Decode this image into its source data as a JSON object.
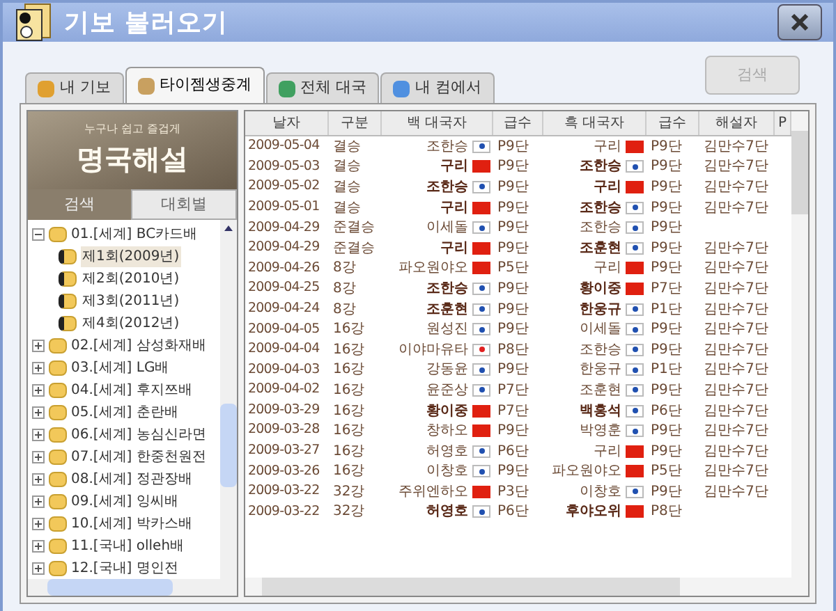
{
  "window": {
    "title": "기보 불러오기"
  },
  "tabs": [
    {
      "label": "내 기보",
      "selected": false
    },
    {
      "label": "타이젬생중계",
      "selected": true
    },
    {
      "label": "전체 대국",
      "selected": false
    },
    {
      "label": "내 컴에서",
      "selected": false
    }
  ],
  "search_button": {
    "label": "검색",
    "disabled": true
  },
  "banner": {
    "tagline": "누구나 쉽고 즐겁게",
    "title": "명국해설"
  },
  "filter_tabs": [
    {
      "label": "검색",
      "selected": true
    },
    {
      "label": "대회별",
      "selected": false
    }
  ],
  "tree": [
    {
      "label": "01.[세계] BC카드배",
      "expanded": true,
      "children": [
        {
          "label": "제1회(2009년)",
          "selected": true
        },
        {
          "label": "제2회(2010년)",
          "selected": false
        },
        {
          "label": "제3회(2011년)",
          "selected": false
        },
        {
          "label": "제4회(2012년)",
          "selected": false
        }
      ]
    },
    {
      "label": "02.[세계] 삼성화재배",
      "expanded": false
    },
    {
      "label": "03.[세계] LG배",
      "expanded": false
    },
    {
      "label": "04.[세계] 후지쯔배",
      "expanded": false
    },
    {
      "label": "05.[세계] 춘란배",
      "expanded": false
    },
    {
      "label": "06.[세계] 농심신라면",
      "expanded": false
    },
    {
      "label": "07.[세계] 한중천원전",
      "expanded": false
    },
    {
      "label": "08.[세계] 정관장배",
      "expanded": false
    },
    {
      "label": "09.[세계] 잉씨배",
      "expanded": false
    },
    {
      "label": "10.[세계] 박카스배",
      "expanded": false
    },
    {
      "label": "11.[국내] olleh배",
      "expanded": false
    },
    {
      "label": "12.[국내] 명인전",
      "expanded": false
    }
  ],
  "table": {
    "columns": [
      "날자",
      "구분",
      "백 대국자",
      "급수",
      "흑 대국자",
      "급수",
      "해설자",
      "P"
    ],
    "rows": [
      {
        "date": "2009-05-04",
        "round": "결승",
        "white": {
          "name": "조한승",
          "kind": "kr",
          "winner": false
        },
        "white_rank": "P9단",
        "black": {
          "name": "구리",
          "kind": "cn",
          "winner": false
        },
        "black_rank": "P9단",
        "commentator": "김만수7단"
      },
      {
        "date": "2009-05-03",
        "round": "결승",
        "white": {
          "name": "구리",
          "kind": "cn",
          "winner": true
        },
        "white_rank": "P9단",
        "black": {
          "name": "조한승",
          "kind": "kr",
          "winner": true
        },
        "black_rank": "P9단",
        "commentator": "김만수7단"
      },
      {
        "date": "2009-05-02",
        "round": "결승",
        "white": {
          "name": "조한승",
          "kind": "kr",
          "winner": true
        },
        "white_rank": "P9단",
        "black": {
          "name": "구리",
          "kind": "cn",
          "winner": true
        },
        "black_rank": "P9단",
        "commentator": "김만수7단"
      },
      {
        "date": "2009-05-01",
        "round": "결승",
        "white": {
          "name": "구리",
          "kind": "cn",
          "winner": true
        },
        "white_rank": "P9단",
        "black": {
          "name": "조한승",
          "kind": "kr",
          "winner": true
        },
        "black_rank": "P9단",
        "commentator": "김만수7단"
      },
      {
        "date": "2009-04-29",
        "round": "준결승",
        "white": {
          "name": "이세돌",
          "kind": "kr",
          "winner": false
        },
        "white_rank": "P9단",
        "black": {
          "name": "조한승",
          "kind": "kr",
          "winner": false
        },
        "black_rank": "P9단"
      },
      {
        "date": "2009-04-29",
        "round": "준결승",
        "white": {
          "name": "구리",
          "kind": "cn",
          "winner": true
        },
        "white_rank": "P9단",
        "black": {
          "name": "조훈현",
          "kind": "kr",
          "winner": true
        },
        "black_rank": "P9단",
        "commentator": "김만수7단"
      },
      {
        "date": "2009-04-26",
        "round": "8강",
        "white": {
          "name": "파오원야오",
          "kind": "cn",
          "winner": false
        },
        "white_rank": "P5단",
        "black": {
          "name": "구리",
          "kind": "cn",
          "winner": false
        },
        "black_rank": "P9단",
        "commentator": "김만수7단"
      },
      {
        "date": "2009-04-25",
        "round": "8강",
        "white": {
          "name": "조한승",
          "kind": "kr",
          "winner": true
        },
        "white_rank": "P9단",
        "black": {
          "name": "황이중",
          "kind": "cn",
          "winner": true
        },
        "black_rank": "P7단",
        "commentator": "김만수7단"
      },
      {
        "date": "2009-04-24",
        "round": "8강",
        "white": {
          "name": "조훈현",
          "kind": "kr",
          "winner": true
        },
        "white_rank": "P9단",
        "black": {
          "name": "한웅규",
          "kind": "kr",
          "winner": true
        },
        "black_rank": "P1단",
        "commentator": "김만수7단"
      },
      {
        "date": "2009-04-05",
        "round": "16강",
        "white": {
          "name": "원성진",
          "kind": "kr",
          "winner": false
        },
        "white_rank": "P9단",
        "black": {
          "name": "이세돌",
          "kind": "kr",
          "winner": false
        },
        "black_rank": "P9단",
        "commentator": "김만수7단"
      },
      {
        "date": "2009-04-04",
        "round": "16강",
        "white": {
          "name": "이야마유타",
          "kind": "jp",
          "winner": false
        },
        "white_rank": "P8단",
        "black": {
          "name": "조한승",
          "kind": "kr",
          "winner": false
        },
        "black_rank": "P9단",
        "commentator": "김만수7단"
      },
      {
        "date": "2009-04-03",
        "round": "16강",
        "white": {
          "name": "강동윤",
          "kind": "kr",
          "winner": false
        },
        "white_rank": "P9단",
        "black": {
          "name": "한웅규",
          "kind": "kr",
          "winner": false
        },
        "black_rank": "P1단",
        "commentator": "김만수7단"
      },
      {
        "date": "2009-04-02",
        "round": "16강",
        "white": {
          "name": "윤준상",
          "kind": "kr",
          "winner": false
        },
        "white_rank": "P7단",
        "black": {
          "name": "조훈현",
          "kind": "kr",
          "winner": false
        },
        "black_rank": "P9단",
        "commentator": "김만수7단"
      },
      {
        "date": "2009-03-29",
        "round": "16강",
        "white": {
          "name": "황이중",
          "kind": "cn",
          "winner": true
        },
        "white_rank": "P7단",
        "black": {
          "name": "백홍석",
          "kind": "kr",
          "winner": true
        },
        "black_rank": "P6단",
        "commentator": "김만수7단"
      },
      {
        "date": "2009-03-28",
        "round": "16강",
        "white": {
          "name": "창하오",
          "kind": "cn",
          "winner": false
        },
        "white_rank": "P9단",
        "black": {
          "name": "박영훈",
          "kind": "kr",
          "winner": false
        },
        "black_rank": "P9단",
        "commentator": "김만수7단"
      },
      {
        "date": "2009-03-27",
        "round": "16강",
        "white": {
          "name": "허영호",
          "kind": "kr",
          "winner": false
        },
        "white_rank": "P6단",
        "black": {
          "name": "구리",
          "kind": "cn",
          "winner": false
        },
        "black_rank": "P9단",
        "commentator": "김만수7단"
      },
      {
        "date": "2009-03-26",
        "round": "16강",
        "white": {
          "name": "이창호",
          "kind": "kr",
          "winner": false
        },
        "white_rank": "P9단",
        "black": {
          "name": "파오원야오",
          "kind": "cn",
          "winner": false
        },
        "black_rank": "P5단",
        "commentator": "김만수7단"
      },
      {
        "date": "2009-03-22",
        "round": "32강",
        "white": {
          "name": "주위엔하오",
          "kind": "cn",
          "winner": false
        },
        "white_rank": "P3단",
        "black": {
          "name": "이창호",
          "kind": "kr",
          "winner": false
        },
        "black_rank": "P9단",
        "commentator": "김만수7단"
      },
      {
        "date": "2009-03-22",
        "round": "32강",
        "white": {
          "name": "허영호",
          "kind": "kr",
          "winner": true
        },
        "white_rank": "P6단",
        "black": {
          "name": "후야오위",
          "kind": "cn",
          "winner": true
        },
        "black_rank": "P8단"
      }
    ]
  }
}
